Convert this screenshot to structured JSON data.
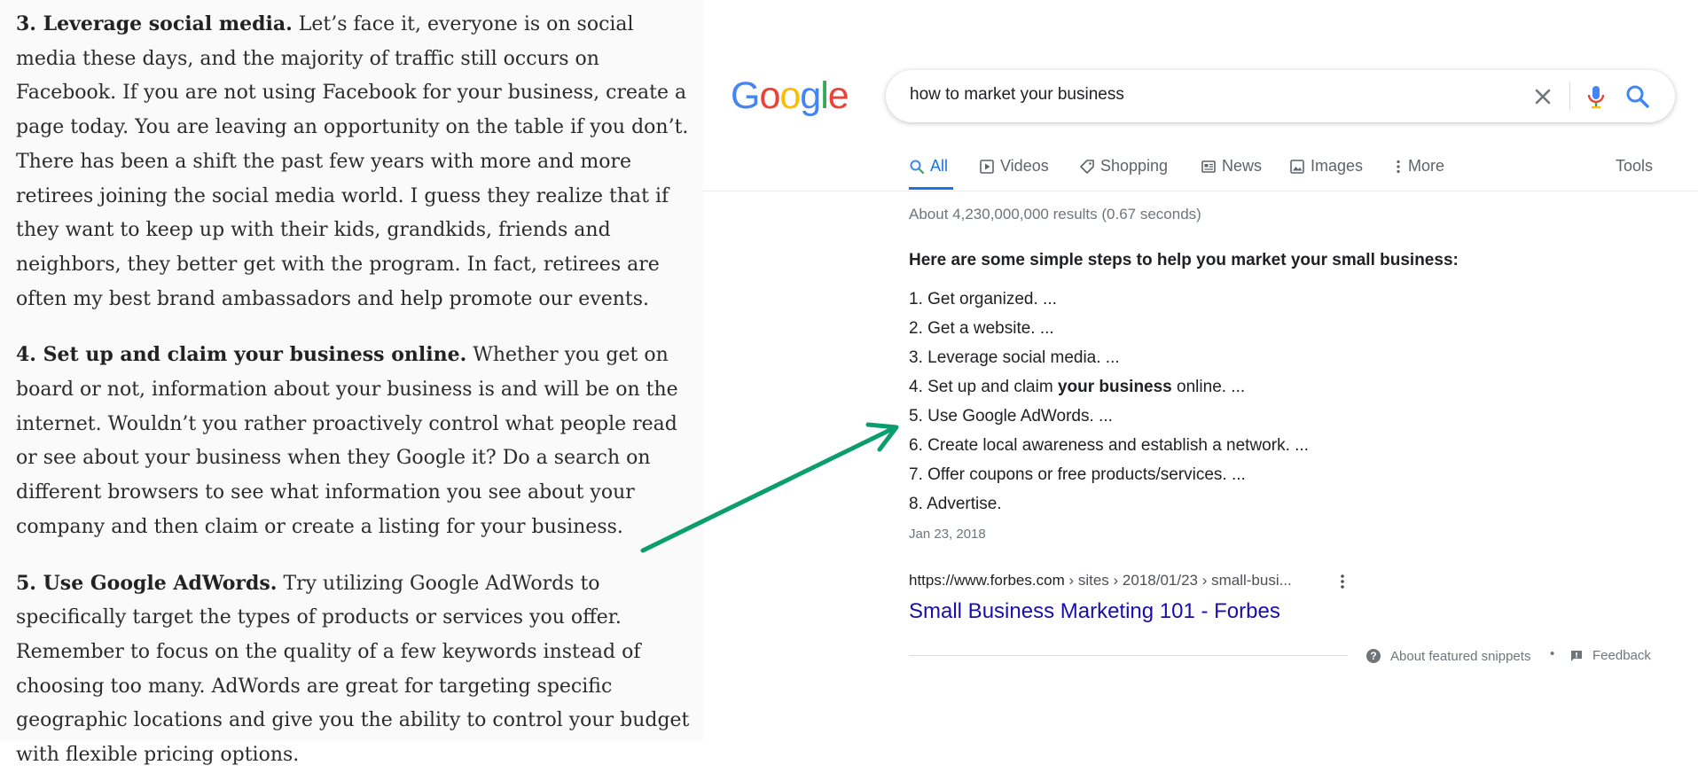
{
  "article": {
    "paragraphs": [
      {
        "heading": "3. Leverage social media.",
        "body": " Let’s face it, everyone is on social media these days, and the majority of traffic still occurs on Facebook. If you are not using Facebook for your business, create a page today. You are leaving an opportunity on the table if you don’t. There has been a shift the past few years with more and more retirees joining the social media world. I guess they realize that if they want to keep up with their kids, grandkids, friends and neighbors, they better get with the program. In fact, retirees are often my best brand ambassadors and help promote our events."
      },
      {
        "heading": "4. Set up and claim your business online.",
        "body": " Whether you get on board or not, information about your business is and will be on the internet. Wouldn’t you rather proactively control what people read or see about your business when they Google it? Do a search on different browsers to see what information you see about your company and then claim or create a listing for your business."
      },
      {
        "heading": "5. Use Google AdWords.",
        "body": " Try utilizing Google AdWords to specifically target the types of products or services you offer. Remember to focus on the quality of a few keywords instead of choosing too many. AdWords are great for targeting specific geographic locations and give you the ability to control your budget with flexible pricing options."
      }
    ]
  },
  "google": {
    "logo_letters": [
      {
        "char": "G",
        "color": "#4285F4"
      },
      {
        "char": "o",
        "color": "#EA4335"
      },
      {
        "char": "o",
        "color": "#FBBC05"
      },
      {
        "char": "g",
        "color": "#4285F4"
      },
      {
        "char": "l",
        "color": "#34A853"
      },
      {
        "char": "e",
        "color": "#EA4335"
      }
    ],
    "search": {
      "query": "how to market your business"
    },
    "tabs": [
      {
        "label": "All",
        "icon": "search-icon",
        "active": true
      },
      {
        "label": "Videos",
        "icon": "video-icon"
      },
      {
        "label": "Shopping",
        "icon": "tag-icon"
      },
      {
        "label": "News",
        "icon": "news-icon"
      },
      {
        "label": "Images",
        "icon": "image-icon"
      },
      {
        "label": "More",
        "icon": "vertical-dots-icon"
      },
      {
        "label": "Tools"
      }
    ],
    "result_stats": "About 4,230,000,000 results (0.67 seconds)",
    "snippet": {
      "heading": "Here are some simple steps to help you market your small business:",
      "steps": [
        {
          "pre": "Get organized. ...",
          "bold": "",
          "post": ""
        },
        {
          "pre": "Get a website. ...",
          "bold": "",
          "post": ""
        },
        {
          "pre": "Leverage social media. ...",
          "bold": "",
          "post": ""
        },
        {
          "pre": "Set up and claim ",
          "bold": "your business",
          "post": " online. ..."
        },
        {
          "pre": "Use Google AdWords. ...",
          "bold": "",
          "post": ""
        },
        {
          "pre": "Create local awareness and establish a network. ...",
          "bold": "",
          "post": ""
        },
        {
          "pre": "Offer coupons or free products/services. ...",
          "bold": "",
          "post": ""
        },
        {
          "pre": "Advertise.",
          "bold": "",
          "post": ""
        }
      ],
      "date": "Jan 23, 2018",
      "cite_domain": "https://www.forbes.com",
      "cite_path": " › sites › 2018/01/23 › small-busi...",
      "result_title": "Small Business Marketing 101 - Forbes",
      "about_label": "About featured snippets",
      "separator": "•",
      "feedback_label": "Feedback"
    }
  },
  "colors": {
    "accent_blue": "#1a73e8",
    "link_blue": "#1a0dab",
    "arrow_green": "#0a9e6e",
    "mic_blue": "#4285F4",
    "mic_red": "#EA4335"
  }
}
